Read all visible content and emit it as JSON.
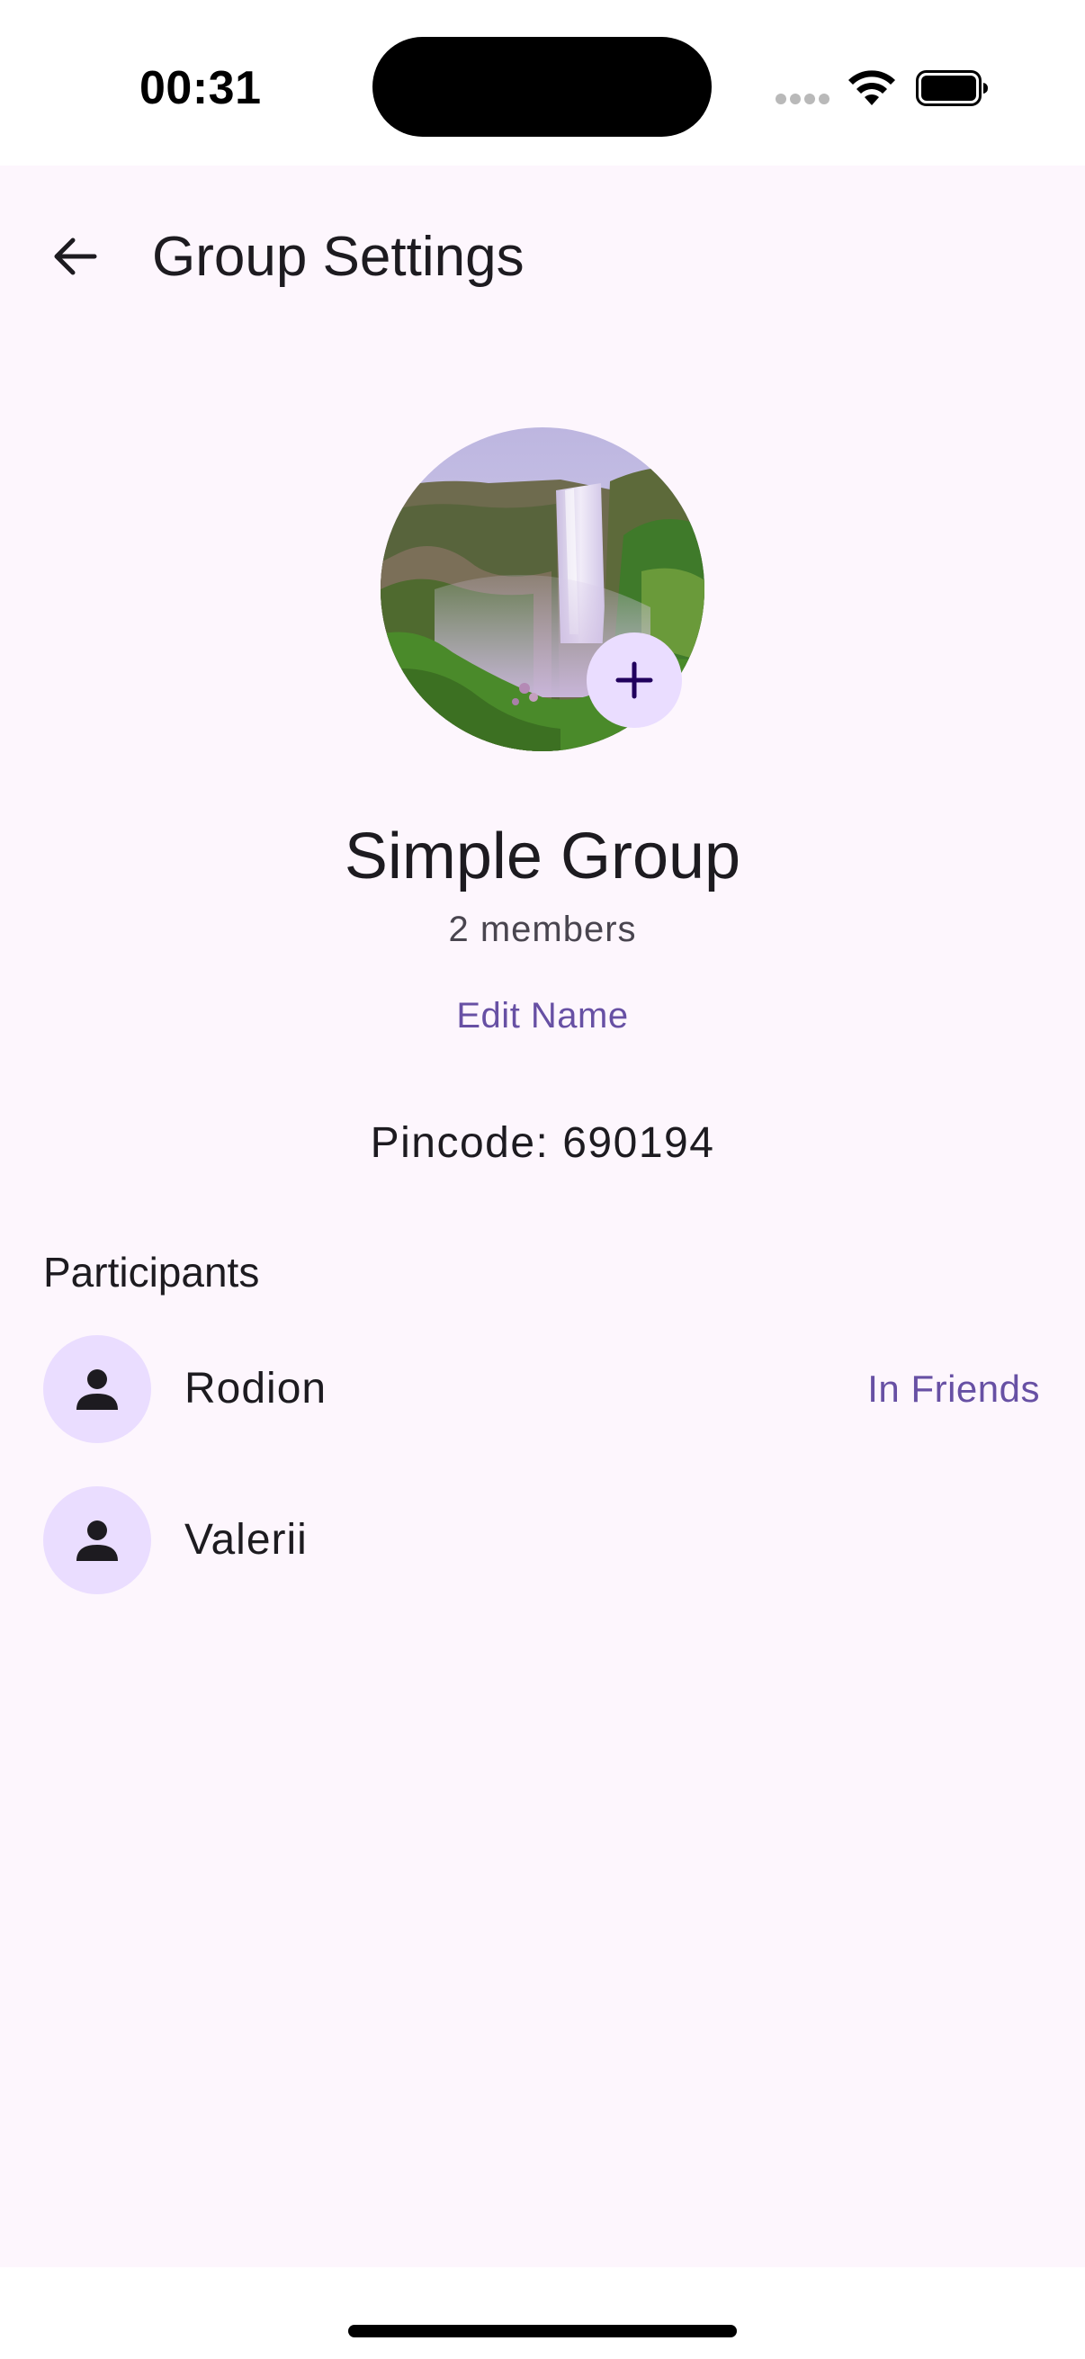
{
  "status_bar": {
    "time": "00:31",
    "icons": [
      "cellular-signal-icon",
      "wifi-icon",
      "battery-icon"
    ]
  },
  "top_bar": {
    "back_icon": "arrow-left-icon",
    "title": "Group Settings"
  },
  "group": {
    "avatar_image": "waterfall-photo",
    "add_photo_icon": "plus-icon",
    "name": "Simple Group",
    "member_count": "2 members",
    "edit_name_label": "Edit Name",
    "pincode": "Pincode: 690194"
  },
  "participants": {
    "title": "Participants",
    "items": [
      {
        "name": "Rodion",
        "status": "In Friends",
        "avatar_icon": "person-icon"
      },
      {
        "name": "Valerii",
        "status": "",
        "avatar_icon": "person-icon"
      }
    ]
  },
  "colors": {
    "background": "#fdf6fd",
    "accent": "#6750a4",
    "avatar_bg": "#eaddff",
    "text_primary": "#1d1b20",
    "text_secondary": "#49454f"
  }
}
